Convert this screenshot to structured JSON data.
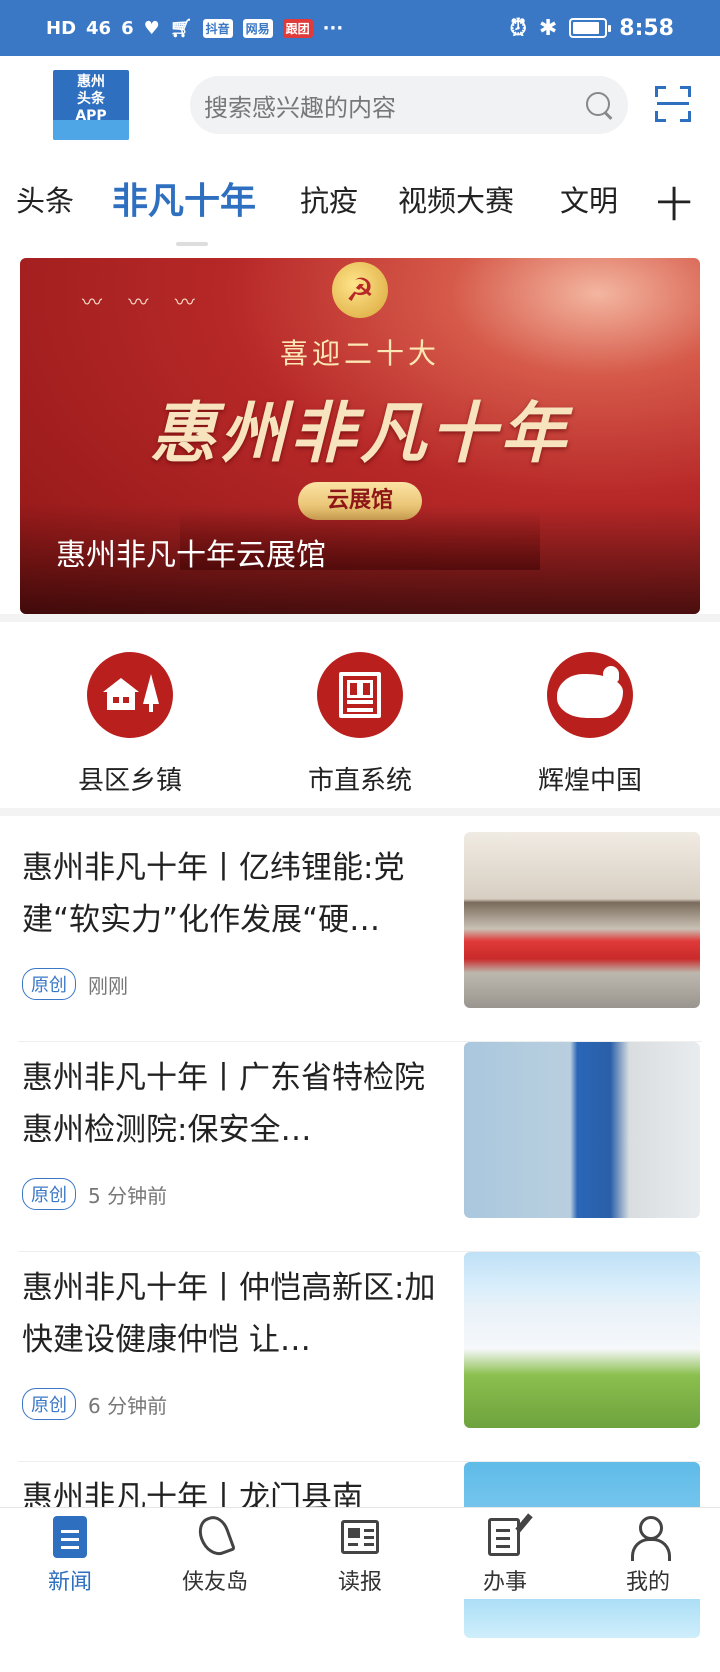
{
  "status_bar": {
    "network_left": "HD",
    "signal": "46",
    "wifi": "6",
    "chips": [
      "抖音",
      "网易",
      "跟团"
    ],
    "more": "···",
    "time": "8:58",
    "battery_level": 0.85
  },
  "header": {
    "logo_text_line1": "惠州",
    "logo_text_line2": "头条",
    "logo_text_line3": "APP",
    "search_placeholder": "搜索感兴趣的内容"
  },
  "tabs": {
    "items": [
      "头条",
      "非凡十年",
      "抗疫",
      "视频大赛",
      "文明"
    ],
    "active_index": 1,
    "more_label": "十"
  },
  "banner": {
    "slogan": "喜迎二十大",
    "calligraphy": "惠州非凡十年",
    "pill": "云展馆",
    "caption": "惠州非凡十年云展馆"
  },
  "quick_links": [
    {
      "label": "县区乡镇",
      "icon": "house-tree-icon"
    },
    {
      "label": "市直系统",
      "icon": "gate-icon"
    },
    {
      "label": "辉煌中国",
      "icon": "china-map-icon"
    }
  ],
  "news": [
    {
      "title": "惠州非凡十年丨亿纬锂能:党建“软实力”化作发展“硬…",
      "tag": "原创",
      "time": "刚刚"
    },
    {
      "title": "惠州非凡十年丨广东省特检院惠州检测院:保安全…",
      "tag": "原创",
      "time": "5 分钟前"
    },
    {
      "title": "惠州非凡十年丨仲恺高新区:加快建设健康仲恺 让…",
      "tag": "原创",
      "time": "6 分钟前"
    },
    {
      "title": "惠州非凡十年丨龙门县南",
      "tag": "",
      "time": ""
    }
  ],
  "bottom_nav": [
    {
      "label": "新闻",
      "icon": "news-icon"
    },
    {
      "label": "侠友岛",
      "icon": "runner-icon"
    },
    {
      "label": "读报",
      "icon": "newspaper-icon"
    },
    {
      "label": "办事",
      "icon": "task-icon"
    },
    {
      "label": "我的",
      "icon": "profile-icon"
    }
  ],
  "colors": {
    "brand_blue": "#2f6fbf",
    "status_blue": "#3a78c6",
    "red": "#b9201d"
  }
}
